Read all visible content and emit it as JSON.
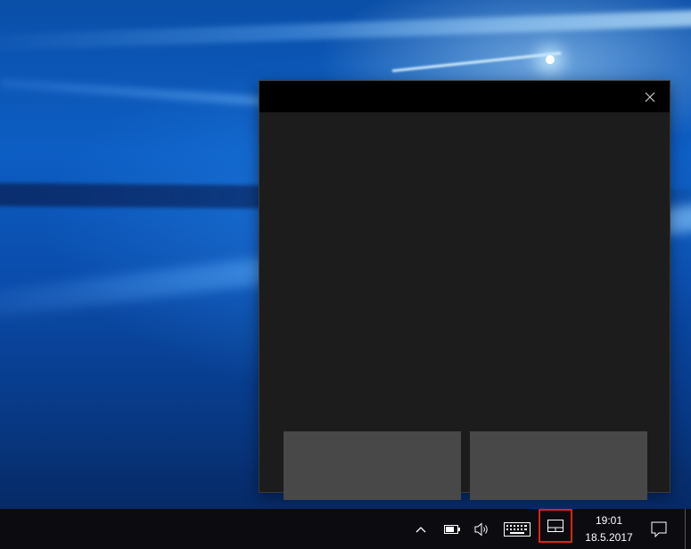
{
  "window": {
    "close_icon": "close-icon",
    "left_button_icon": "",
    "right_button_icon": ""
  },
  "taskbar": {
    "tray_icons": [
      "chevron-up-icon",
      "battery-icon",
      "speaker-icon",
      "keyboard-icon",
      "touchpad-icon",
      "notification-icon"
    ],
    "clock": {
      "time": "19:01",
      "date": "18.5.2017"
    }
  },
  "colors": {
    "taskbar": "#0c0c10",
    "window_title": "#000000",
    "window_surface": "#1c1c1c",
    "touchpad_button": "#484848",
    "highlight": "#e0201a"
  }
}
